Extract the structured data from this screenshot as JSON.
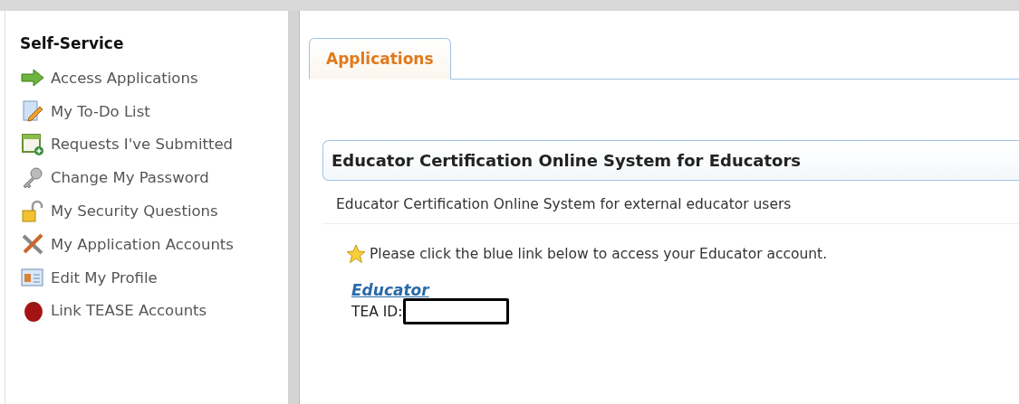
{
  "sidebar": {
    "title": "Self-Service",
    "items": [
      {
        "label": "Access Applications"
      },
      {
        "label": "My To-Do List"
      },
      {
        "label": "Requests I've Submitted"
      },
      {
        "label": "Change My Password"
      },
      {
        "label": "My Security Questions"
      },
      {
        "label": "My Application Accounts"
      },
      {
        "label": "Edit My Profile"
      },
      {
        "label": "Link TEASE Accounts"
      }
    ]
  },
  "tabs": [
    {
      "label": "Applications",
      "selected": true
    }
  ],
  "panel": {
    "title": "Educator Certification Online System for Educators",
    "description": "Educator Certification Online System for external educator users",
    "note": "Please click the blue link below to access your Educator account.",
    "link": "Educator",
    "id_label": "TEA ID:"
  }
}
